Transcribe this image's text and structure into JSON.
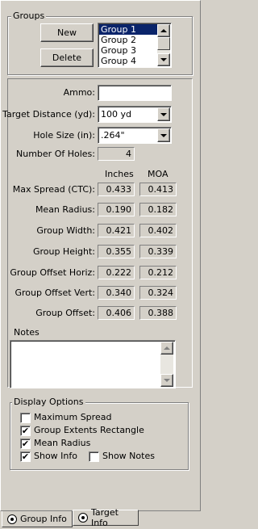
{
  "groups": {
    "title": "Groups",
    "new_label": "New",
    "delete_label": "Delete",
    "items": [
      "Group 1",
      "Group 2",
      "Group 3",
      "Group 4"
    ],
    "selected": "Group 1"
  },
  "fields": {
    "ammo_label": "Ammo:",
    "ammo_value": "",
    "distance_label": "Target Distance (yd):",
    "distance_value": "100 yd",
    "hole_size_label": "Hole Size (in):",
    "hole_size_value": ".264\"",
    "holes_label": "Number Of Holes:",
    "holes_value": "4"
  },
  "stats": {
    "col_inches": "Inches",
    "col_moa": "MOA",
    "rows": [
      {
        "label": "Max Spread (CTC):",
        "inches": "0.433",
        "moa": "0.413"
      },
      {
        "label": "Mean Radius:",
        "inches": "0.190",
        "moa": "0.182"
      },
      {
        "label": "Group Width:",
        "inches": "0.421",
        "moa": "0.402"
      },
      {
        "label": "Group Height:",
        "inches": "0.355",
        "moa": "0.339"
      },
      {
        "label": "Group Offset Horiz:",
        "inches": "0.222",
        "moa": "0.212"
      },
      {
        "label": "Group Offset Vert:",
        "inches": "0.340",
        "moa": "0.324"
      },
      {
        "label": "Group Offset:",
        "inches": "0.406",
        "moa": "0.388"
      }
    ]
  },
  "notes": {
    "label": "Notes",
    "value": ""
  },
  "display_options": {
    "title": "Display Options",
    "max_spread": {
      "label": "Maximum Spread",
      "checked": false
    },
    "extents_rect": {
      "label": "Group Extents Rectangle",
      "checked": true
    },
    "mean_radius": {
      "label": "Mean Radius",
      "checked": true
    },
    "show_info": {
      "label": "Show Info",
      "checked": true
    },
    "show_notes": {
      "label": "Show Notes",
      "checked": false
    }
  },
  "tabs": {
    "group_info": "Group Info",
    "target_info": "Target Info",
    "active": "Group Info"
  },
  "check_mark": "✔"
}
